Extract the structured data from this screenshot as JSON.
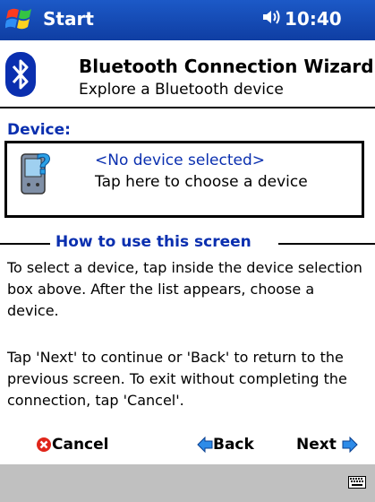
{
  "titlebar": {
    "app_label": "Start",
    "time": "10:40",
    "speaker_glyph": "◀€"
  },
  "wizard": {
    "title": "Bluetooth Connection Wizard",
    "subtitle": "Explore a Bluetooth device"
  },
  "device": {
    "label": "Device:",
    "name": "<No device selected>",
    "hint": "Tap here to choose a device"
  },
  "howto": {
    "title": "How to use this screen",
    "para1": "To select a device, tap inside the device selection box above. After the list appears, choose a device.",
    "para2": "Tap 'Next' to continue or 'Back' to return to the previous screen. To exit without completing the connection, tap 'Cancel'."
  },
  "buttons": {
    "cancel": "Cancel",
    "back": "Back",
    "next": "Next"
  },
  "colors": {
    "titlebar": "#1c59c7",
    "accent_text": "#0a2faf",
    "bottombar": "#c0c0c0"
  },
  "icons": [
    "windows-start-logo-icon",
    "speaker-icon",
    "bluetooth-icon",
    "device-question-icon",
    "cancel-icon",
    "back-arrow-icon",
    "next-arrow-icon",
    "keyboard-icon"
  ]
}
